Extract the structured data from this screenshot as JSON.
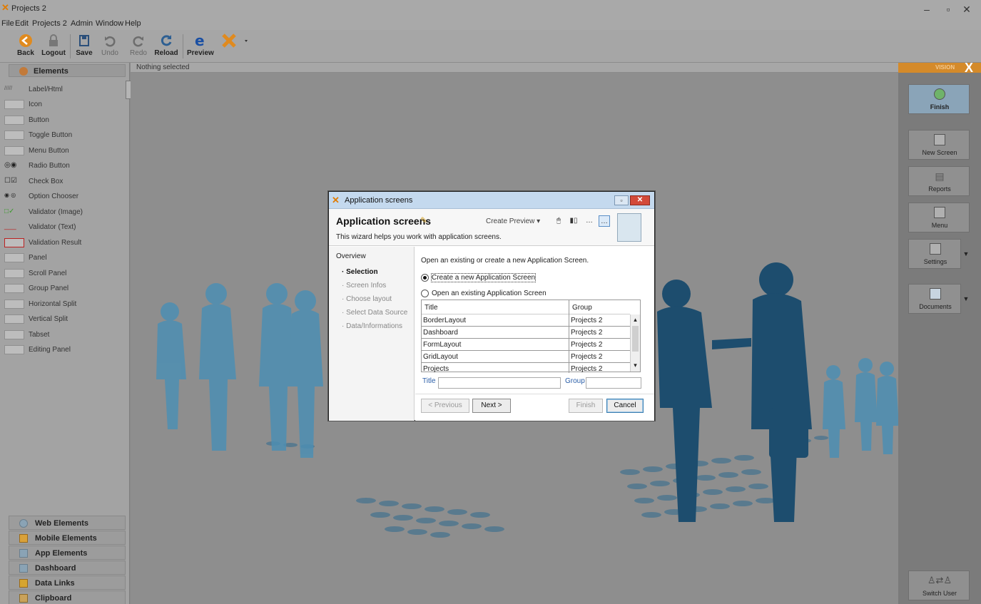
{
  "window": {
    "title": "Projects 2",
    "controls": {
      "minimize": "–",
      "maximize": "▫",
      "close": "✕"
    }
  },
  "menubar": [
    "File",
    "Edit",
    "Projects 2",
    "Admin",
    "Window",
    "Help"
  ],
  "toolbar": {
    "back": "Back",
    "logout": "Logout",
    "save": "Save",
    "undo": "Undo",
    "redo": "Redo",
    "reload": "Reload",
    "preview": "Preview"
  },
  "left_panel": {
    "header": "Elements",
    "items": [
      "Label/Html",
      "Icon",
      "Button",
      "Toggle Button",
      "Menu Button",
      "Radio Button",
      "Check Box",
      "Option Chooser",
      "Validator (Image)",
      "Validator (Text)",
      "Validation Result",
      "Panel",
      "Scroll Panel",
      "Group Panel",
      "Horizontal Split",
      "Vertical Split",
      "Tabset",
      "Editing Panel"
    ],
    "sections": [
      "Web Elements",
      "Mobile Elements",
      "App Elements",
      "Dashboard",
      "Data Links",
      "Clipboard"
    ]
  },
  "canvas": {
    "status": "Nothing selected"
  },
  "right_panel": {
    "brand": "VISION",
    "buttons": [
      "Finish",
      "New Screen",
      "Reports",
      "Menu",
      "Settings",
      "Documents",
      "Switch User"
    ]
  },
  "dialog": {
    "title": "Application screens",
    "heading": "Application screens",
    "subtitle": "This wizard helps you work with application screens.",
    "create_preview": "Create Preview",
    "nav": {
      "overview": "Overview",
      "steps": [
        "Selection",
        "Screen Infos",
        "Choose layout",
        "Select Data Source",
        "Data/Informations"
      ]
    },
    "prompt": "Open an existing or create a new Application Screen.",
    "option_create": "Create a new Application Screen",
    "option_open": "Open an existing Application Screen",
    "table": {
      "columns": [
        "Title",
        "Group"
      ],
      "rows": [
        [
          "BorderLayout",
          "Projects 2"
        ],
        [
          "Dashboard",
          "Projects 2"
        ],
        [
          "FormLayout",
          "Projects 2"
        ],
        [
          "GridLayout",
          "Projects 2"
        ],
        [
          "Projects",
          "Projects 2"
        ]
      ]
    },
    "filter_title_label": "Title",
    "filter_group_label": "Group",
    "filter_title_value": "",
    "filter_group_value": "",
    "buttons": {
      "previous": "< Previous",
      "next": "Next >",
      "finish": "Finish",
      "cancel": "Cancel"
    }
  },
  "colors": {
    "accent": "#d48a2a",
    "silhouette_dark": "#1d4d6e",
    "silhouette_light": "#3f7fa3"
  }
}
